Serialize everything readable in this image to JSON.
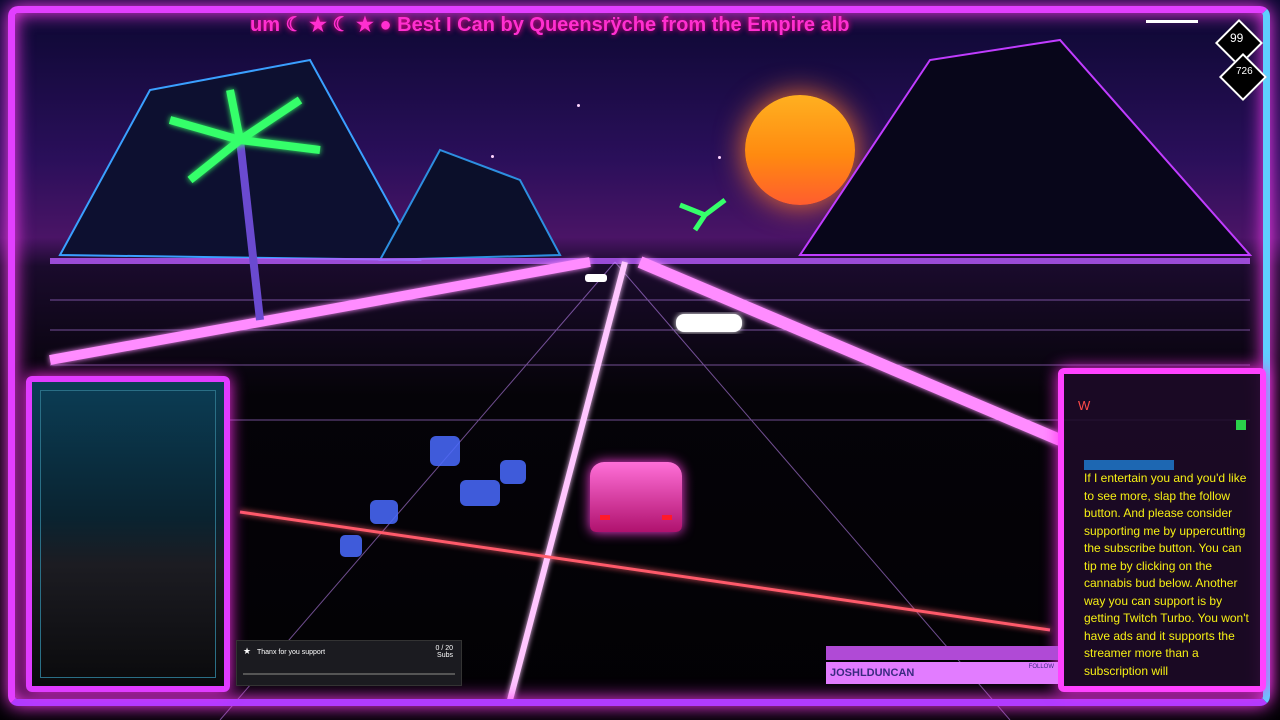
{
  "ticker": {
    "text": "um  ☾  ★         ☾   ★   ● Best I Can by Queensrÿche from the Empire alb"
  },
  "hud": {
    "top_value": "99",
    "bottom_value": "726"
  },
  "chat": {
    "header_letter": "W",
    "message": "If I entertain you and you'd like to see more, slap the follow button. And please consider supporting me by uppercutting the subscribe button. You can tip me by clicking on the cannabis bud below. Another way you can support is by getting Twitch Turbo. You won't have ads and it supports the streamer more than a subscription will"
  },
  "alert": {
    "label": "Thanx for you support",
    "count": "0 / 20",
    "unit": "Subs",
    "progress": 0
  },
  "follower": {
    "top_name": "",
    "name": "JOSHLDUNCAN",
    "button_label": "FOLLOW"
  },
  "colors": {
    "frame": "#e23fff",
    "ticker": "#ff2fd0",
    "chat_text": "#f6f014",
    "sun": "#ffa21a"
  }
}
